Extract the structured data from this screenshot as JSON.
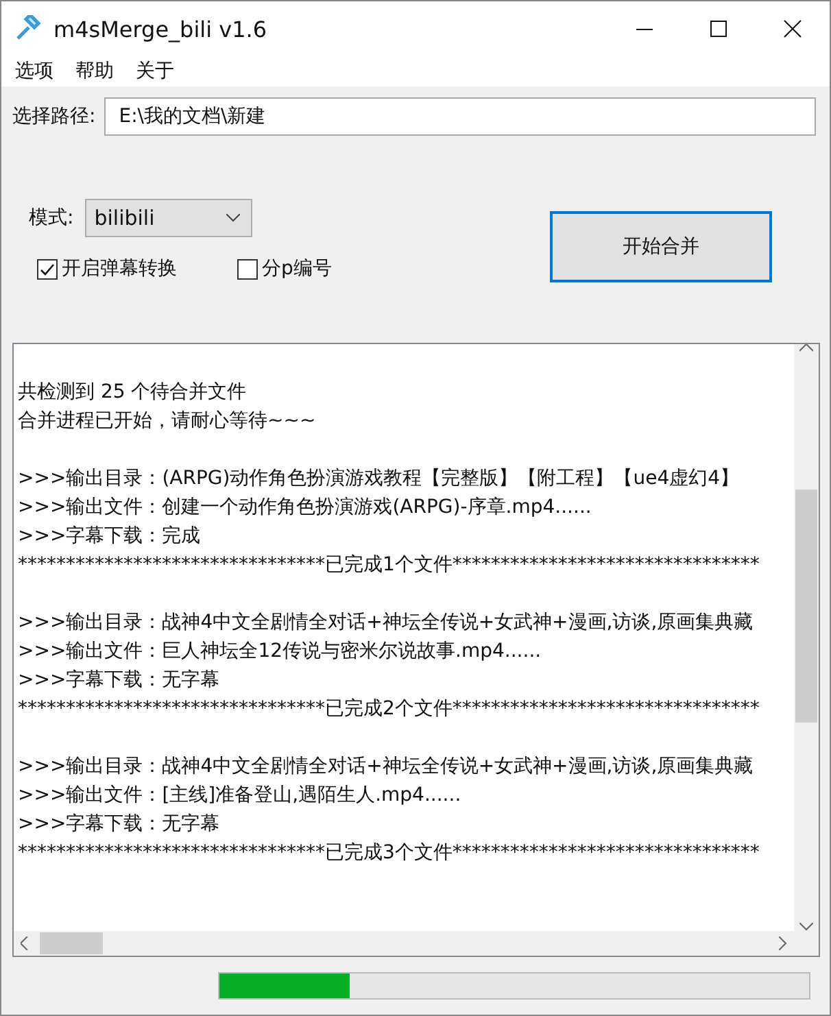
{
  "window": {
    "title": "m4sMerge_bili v1.6"
  },
  "menu": [
    "选项",
    "帮助",
    "关于"
  ],
  "path": {
    "label": "选择路径:",
    "value": "E:\\我的文档\\新建"
  },
  "mode": {
    "label": "模式:",
    "value": "bilibili"
  },
  "options": [
    {
      "label": "开启弹幕转换",
      "checked": true
    },
    {
      "label": "分p编号",
      "checked": false
    }
  ],
  "start_button": {
    "label": "开始合并",
    "focused": true
  },
  "log": [
    {
      "kind": "gap"
    },
    {
      "kind": "text",
      "text": "共检测到 25 个待合并文件"
    },
    {
      "kind": "text",
      "text": "合并进程已开始，请耐心等待~~~"
    },
    {
      "kind": "gap"
    },
    {
      "kind": "text",
      "text": ">>>输出目录：(ARPG)动作角色扮演游戏教程【完整版】【附工程】【ue4虚幻4】"
    },
    {
      "kind": "text",
      "text": ">>>输出文件：创建一个动作角色扮演游戏(ARPG)-序章.mp4......"
    },
    {
      "kind": "text",
      "text": ">>>字幕下载：完成"
    },
    {
      "kind": "text",
      "text": "********************************已完成1个文件********************************"
    },
    {
      "kind": "gap"
    },
    {
      "kind": "text",
      "text": ">>>输出目录：战神4中文全剧情全对话+神坛全传说+女武神+漫画,访谈,原画集典藏"
    },
    {
      "kind": "text",
      "text": ">>>输出文件：巨人神坛全12传说与密米尔说故事.mp4......"
    },
    {
      "kind": "text",
      "text": ">>>字幕下载：无字幕"
    },
    {
      "kind": "text",
      "text": "********************************已完成2个文件********************************"
    },
    {
      "kind": "gap"
    },
    {
      "kind": "text",
      "text": ">>>输出目录：战神4中文全剧情全对话+神坛全传说+女武神+漫画,访谈,原画集典藏"
    },
    {
      "kind": "text",
      "text": ">>>输出文件：[主线]准备登山,遇陌生人.mp4......"
    },
    {
      "kind": "text",
      "text": ">>>字幕下载：无字幕"
    },
    {
      "kind": "text",
      "text": "********************************已完成3个文件********************************"
    }
  ],
  "progress": {
    "level": 0.22
  }
}
